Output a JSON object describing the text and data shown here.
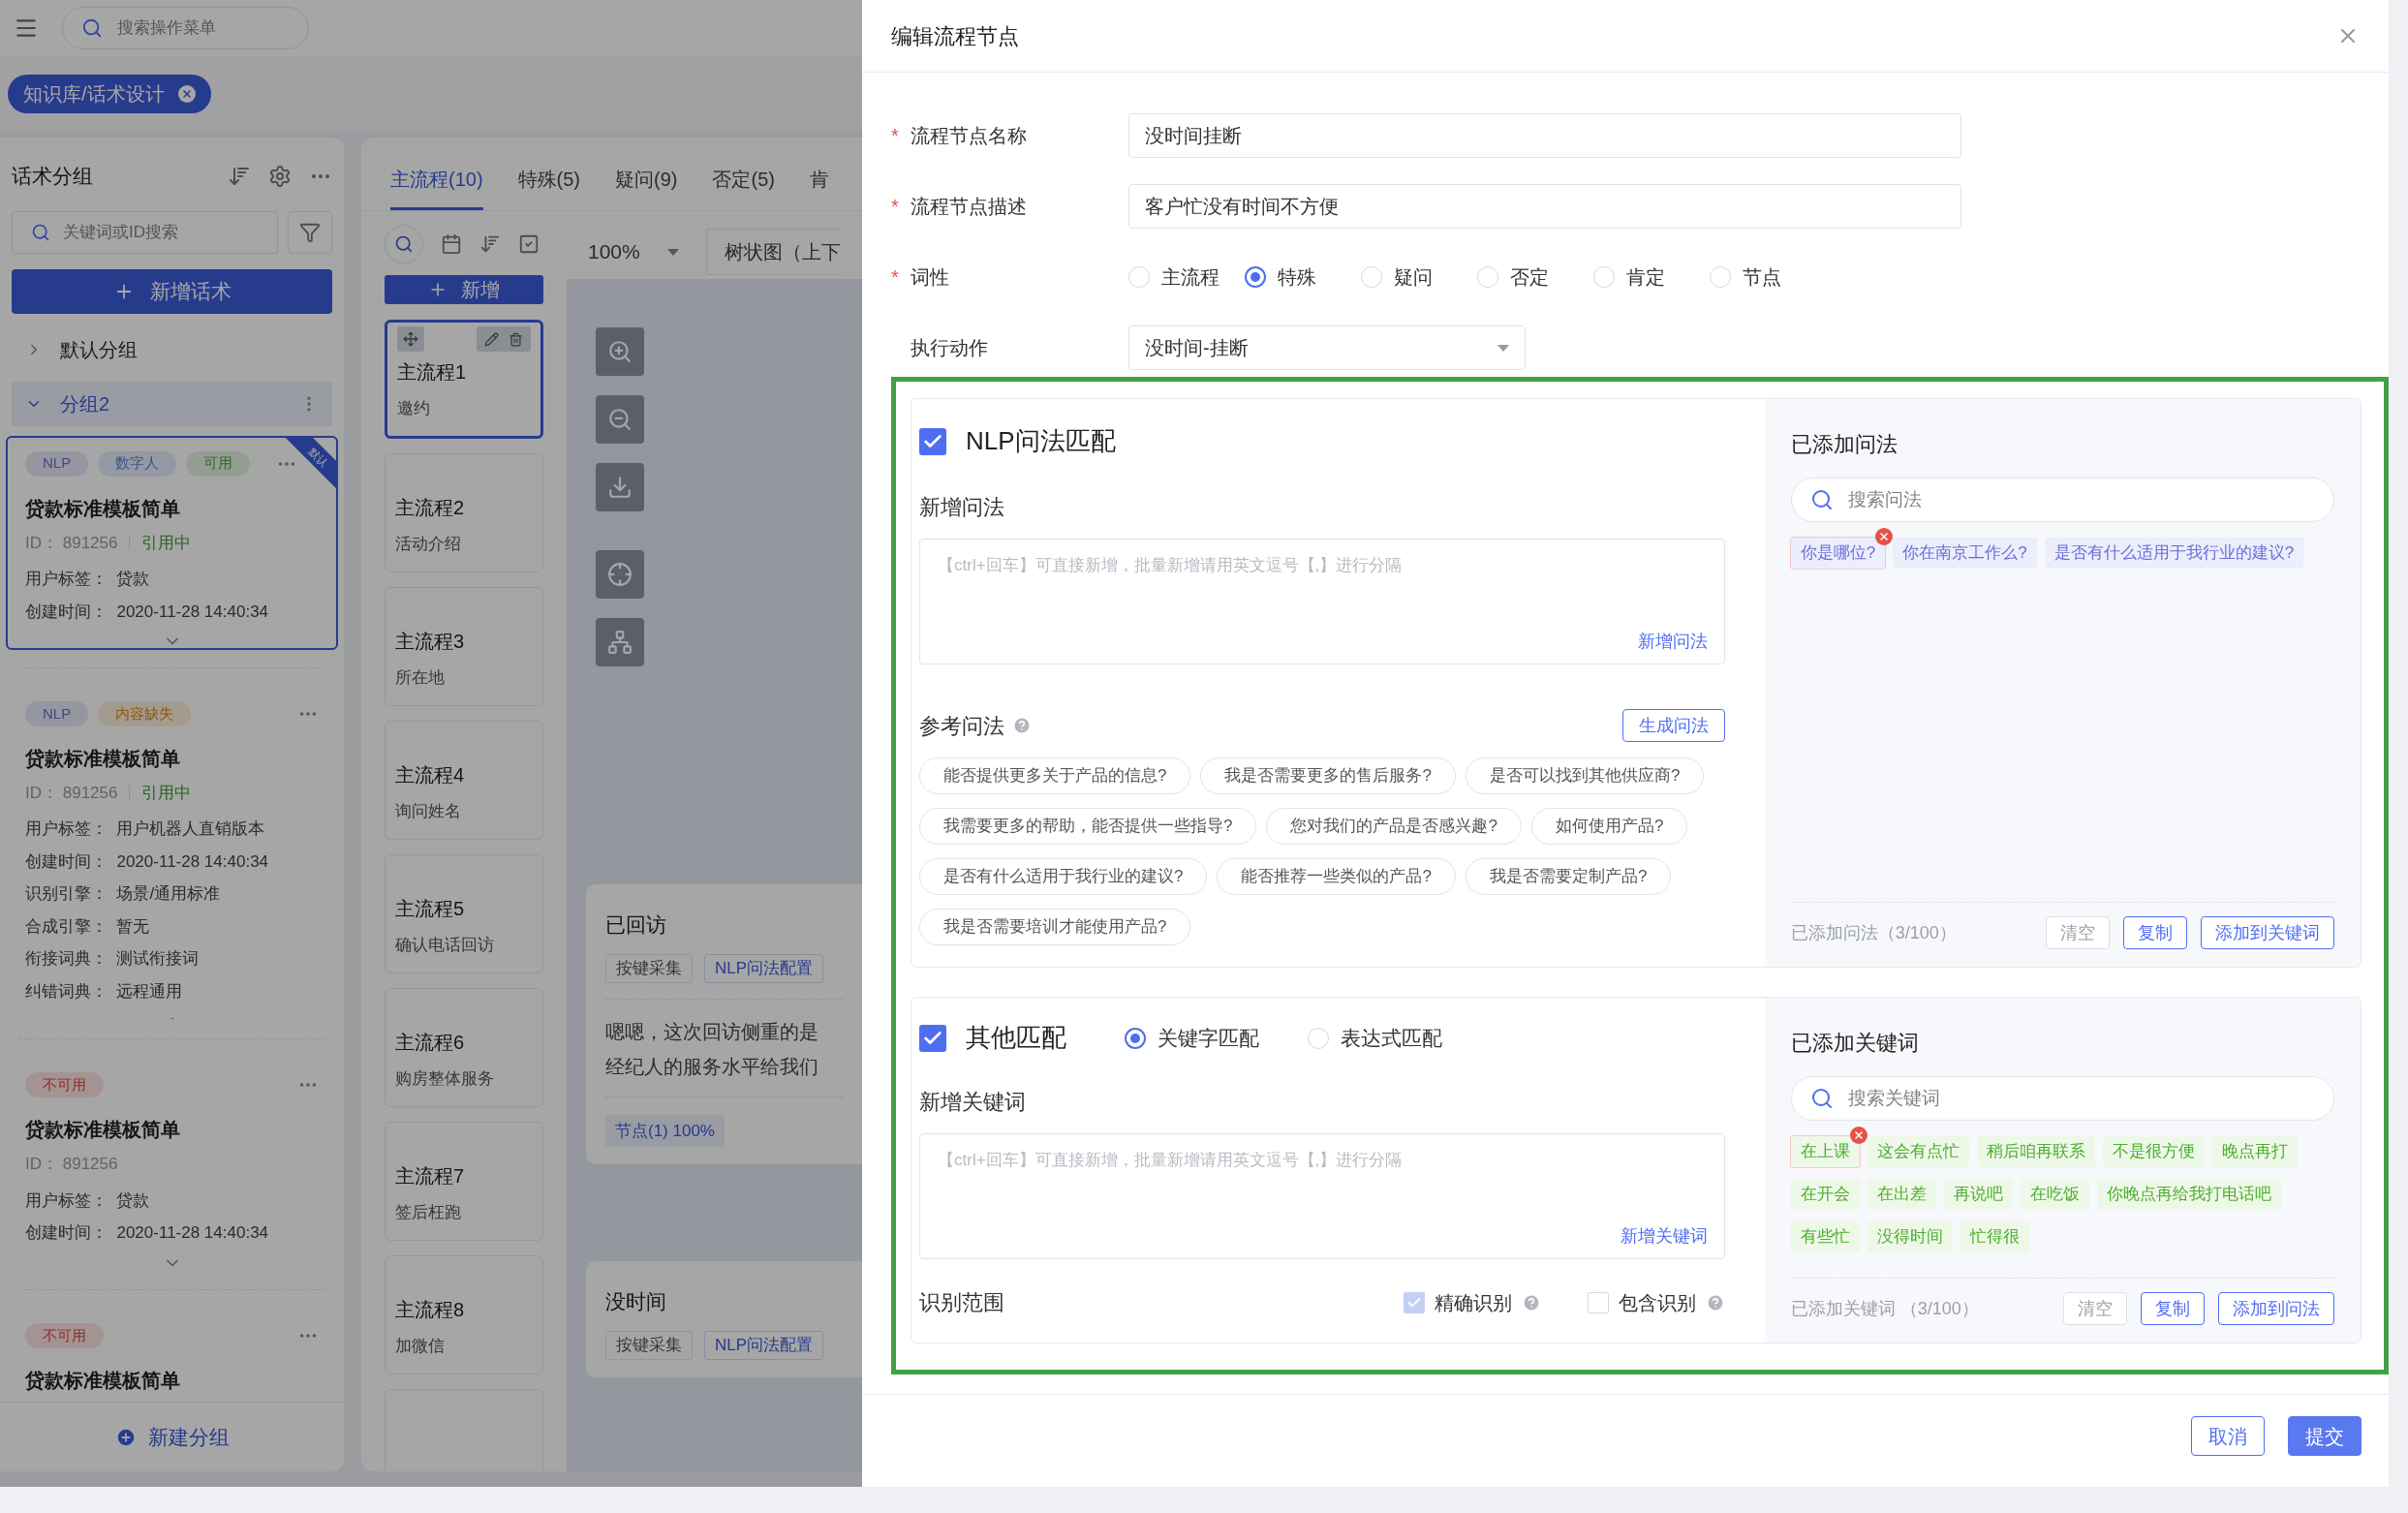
{
  "top_bar": {
    "search": {
      "placeholder": "搜索操作菜单"
    }
  },
  "breadcrumb": {
    "label": "知识库/话术设计"
  },
  "group_panel": {
    "title": "话术分组",
    "search": {
      "placeholder": "关键词或ID搜索"
    },
    "add_button": "新增话术",
    "groups": [
      {
        "label": "默认分组",
        "expanded": false,
        "selected": false
      },
      {
        "label": "分组2",
        "expanded": true,
        "selected": true
      }
    ],
    "cards": [
      {
        "selected": true,
        "ribbon": "默认",
        "tags": [
          {
            "label": "NLP",
            "kind": "engine"
          },
          {
            "label": "数字人",
            "kind": "feature"
          },
          {
            "label": "可用",
            "kind": "ok"
          }
        ],
        "title": "贷款标准模板简单",
        "id_label": "ID：",
        "id": "891256",
        "status": "引用中",
        "fields": [
          {
            "label": "用户标签：",
            "value": "贷款"
          },
          {
            "label": "创建时间：",
            "value": "2020-11-28 14:40:34"
          }
        ],
        "expanded": false
      },
      {
        "selected": false,
        "tags": [
          {
            "label": "NLP",
            "kind": "engine"
          },
          {
            "label": "内容缺失",
            "kind": "warning"
          }
        ],
        "title": "贷款标准模板简单",
        "id_label": "ID：",
        "id": "891256",
        "status": "引用中",
        "fields": [
          {
            "label": "用户标签：",
            "value": "用户机器人直销版本"
          },
          {
            "label": "创建时间：",
            "value": "2020-11-28 14:40:34"
          },
          {
            "label": "识别引擎：",
            "value": "场景/通用标准"
          },
          {
            "label": "合成引擎：",
            "value": "暂无"
          },
          {
            "label": "衔接词典：",
            "value": "测试衔接词"
          },
          {
            "label": "纠错词典：",
            "value": "远程通用"
          }
        ],
        "expanded": true
      },
      {
        "selected": false,
        "tags": [
          {
            "label": "不可用",
            "kind": "error"
          }
        ],
        "title": "贷款标准模板简单",
        "id_label": "ID：",
        "id": "891256",
        "fields": [
          {
            "label": "用户标签：",
            "value": "贷款"
          },
          {
            "label": "创建时间：",
            "value": "2020-11-28 14:40:34"
          }
        ],
        "expanded": false
      },
      {
        "selected": false,
        "tags": [
          {
            "label": "不可用",
            "kind": "error"
          }
        ],
        "title": "贷款标准模板简单"
      }
    ],
    "footer_button": "新建分组"
  },
  "flow_panel": {
    "tabs": [
      {
        "label": "主流程(10)",
        "selected": true
      },
      {
        "label": "特殊(5)",
        "selected": false
      },
      {
        "label": "疑问(9)",
        "selected": false
      },
      {
        "label": "否定(5)",
        "selected": false
      },
      {
        "label": "肯",
        "selected": false
      }
    ],
    "add_button": "新增",
    "nodes": [
      {
        "title": "主流程1",
        "subtitle": "邀约",
        "selected": true
      },
      {
        "title": "主流程2",
        "subtitle": "活动介绍",
        "selected": false
      },
      {
        "title": "主流程3",
        "subtitle": "所在地",
        "selected": false
      },
      {
        "title": "主流程4",
        "subtitle": "询问姓名",
        "selected": false
      },
      {
        "title": "主流程5",
        "subtitle": "确认电话回访",
        "selected": false
      },
      {
        "title": "主流程6",
        "subtitle": "购房整体服务",
        "selected": false
      },
      {
        "title": "主流程7",
        "subtitle": "签后枉跑",
        "selected": false
      },
      {
        "title": "主流程8",
        "subtitle": "加微信",
        "selected": false
      }
    ]
  },
  "canvas": {
    "zoom": "100%",
    "layout": "树状图（上下",
    "nodes": [
      {
        "title": "已回访",
        "tags": [
          {
            "label": "按键采集",
            "kind": "plain"
          },
          {
            "label": "NLP问法配置",
            "kind": "accent"
          }
        ],
        "lines": [
          "嗯嗯，这次回访侧重的是",
          "经纪人的服务水平给我们"
        ],
        "footer": "节点(1) 100%"
      },
      {
        "title": "没时间",
        "tags": [
          {
            "label": "按键采集",
            "kind": "plain"
          },
          {
            "label": "NLP问法配置",
            "kind": "accent"
          }
        ]
      }
    ]
  },
  "dialog": {
    "title": "编辑流程节点",
    "required_mark": "*",
    "fields": [
      {
        "label": "流程节点名称",
        "required": true,
        "kind": "text",
        "value": "没时间挂断"
      },
      {
        "label": "流程节点描述",
        "required": true,
        "kind": "text",
        "value": "客户忙没有时间不方便"
      },
      {
        "label": "词性",
        "required": true,
        "kind": "radio",
        "options": [
          {
            "label": "主流程",
            "selected": false
          },
          {
            "label": "特殊",
            "selected": true
          },
          {
            "label": "疑问",
            "selected": false
          },
          {
            "label": "否定",
            "selected": false
          },
          {
            "label": "肯定",
            "selected": false
          },
          {
            "label": "节点",
            "selected": false
          }
        ]
      },
      {
        "label": "执行动作",
        "required": false,
        "kind": "select",
        "value": "没时间-挂断"
      }
    ],
    "nlp_section": {
      "checked": true,
      "title": "NLP问法匹配",
      "add_title": "新增问法",
      "add_placeholder": "【ctrl+回车】可直接新增，批量新增请用英文逗号【,】进行分隔",
      "add_link": "新增问法",
      "reference_title": "参考问法",
      "generate_button": "生成问法",
      "references": [
        "能否提供更多关于产品的信息?",
        "我是否需要更多的售后服务?",
        "是否可以找到其他供应商?",
        "我需要更多的帮助，能否提供一些指导?",
        "您对我们的产品是否感兴趣?",
        "如何使用产品?",
        "是否有什么适用于我行业的建议?",
        "能否推荐一些类似的产品?",
        "我是否需要定制产品?",
        "我是否需要培训才能使用产品?"
      ],
      "added_title": "已添加问法",
      "search_placeholder": "搜索问法",
      "added": [
        {
          "label": "你是哪位?",
          "hovered": true
        },
        {
          "label": "你在南京工作么?",
          "hovered": false
        },
        {
          "label": "是否有什么适用于我行业的建议?",
          "hovered": false
        }
      ],
      "count": "已添加问法（3/100）",
      "buttons": [
        {
          "label": "清空",
          "kind": "plain"
        },
        {
          "label": "复制",
          "kind": "outline"
        },
        {
          "label": "添加到关键词",
          "kind": "outline"
        }
      ]
    },
    "other_section": {
      "checked": true,
      "title": "其他匹配",
      "modes": [
        {
          "label": "关键字匹配",
          "selected": true
        },
        {
          "label": "表达式匹配",
          "selected": false
        }
      ],
      "add_title": "新增关键词",
      "add_placeholder": "【ctrl+回车】可直接新增，批量新增请用英文逗号【,】进行分隔",
      "add_link": "新增关键词",
      "scope_title": "识别范围",
      "scope_options": [
        {
          "label": "精确识别",
          "checked": true
        },
        {
          "label": "包含识别",
          "checked": false
        }
      ],
      "added_title": "已添加关键词",
      "search_placeholder": "搜索关键词",
      "added": [
        {
          "label": "在上课",
          "hovered": true
        },
        {
          "label": "这会有点忙",
          "hovered": false
        },
        {
          "label": "稍后咱再联系",
          "hovered": false
        },
        {
          "label": "不是很方便",
          "hovered": false
        },
        {
          "label": "晚点再打",
          "hovered": false
        },
        {
          "label": "在开会",
          "hovered": false
        },
        {
          "label": "在出差",
          "hovered": false
        },
        {
          "label": "再说吧",
          "hovered": false
        },
        {
          "label": "在吃饭",
          "hovered": false
        },
        {
          "label": "你晚点再给我打电话吧",
          "hovered": false
        },
        {
          "label": "有些忙",
          "hovered": false
        },
        {
          "label": "没得时间",
          "hovered": false
        },
        {
          "label": "忙得很",
          "hovered": false
        }
      ],
      "count": "已添加关键词 （3/100）",
      "buttons": [
        {
          "label": "清空",
          "kind": "plain"
        },
        {
          "label": "复制",
          "kind": "outline"
        },
        {
          "label": "添加到问法",
          "kind": "outline"
        }
      ]
    },
    "footer_buttons": [
      {
        "label": "取消",
        "kind": "outline"
      },
      {
        "label": "提交",
        "kind": "primary"
      }
    ]
  }
}
